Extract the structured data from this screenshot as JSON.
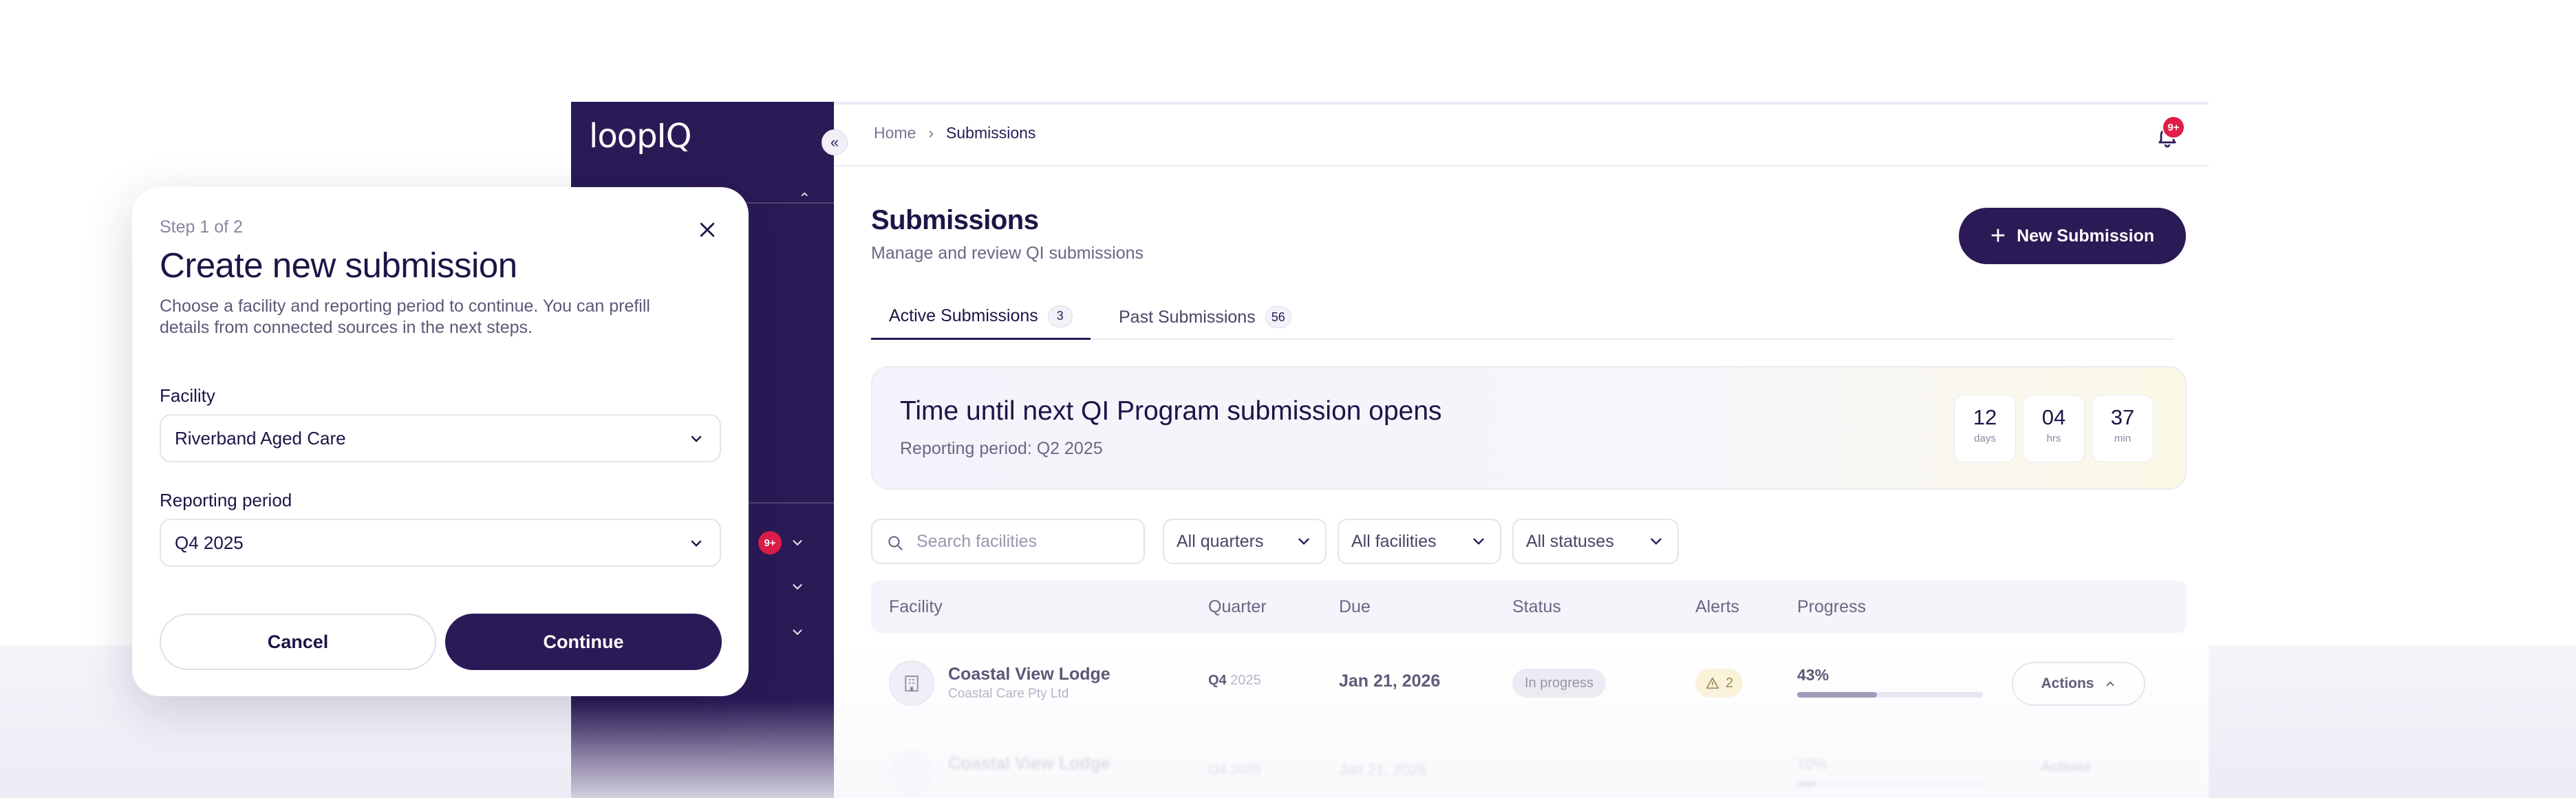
{
  "app": {
    "logo": "loopIQ"
  },
  "sidebar": {
    "partial_text": "t",
    "badge": "9+"
  },
  "breadcrumb": {
    "home": "Home",
    "separator": "›",
    "current": "Submissions"
  },
  "notifications": {
    "badge": "9+"
  },
  "page": {
    "title": "Submissions",
    "subtitle": "Manage and review QI submissions",
    "new_button": "New Submission"
  },
  "tabs": [
    {
      "label": "Active Submissions",
      "count": "3",
      "active": true
    },
    {
      "label": "Past Submissions",
      "count": "56",
      "active": false
    }
  ],
  "banner": {
    "title": "Time until next QI Program submission opens",
    "subtitle": "Reporting period: Q2 2025",
    "countdown": [
      {
        "value": "12",
        "unit": "days"
      },
      {
        "value": "04",
        "unit": "hrs"
      },
      {
        "value": "37",
        "unit": "min"
      }
    ]
  },
  "filters": {
    "search_placeholder": "Search facilities",
    "quarters": "All quarters",
    "facilities": "All facilities",
    "statuses": "All statuses"
  },
  "table": {
    "columns": [
      "Facility",
      "Quarter",
      "Due",
      "Status",
      "Alerts",
      "Progress"
    ],
    "rows": [
      {
        "facility": "Coastal View Lodge",
        "organisation": "Coastal Care Pty Ltd",
        "quarter": "Q4",
        "year": "2025",
        "due": "Jan 21, 2026",
        "status": "In progress",
        "alerts": "2",
        "progress": 0.43,
        "progress_label": "43%",
        "actions": "Actions"
      },
      {
        "facility": "Coastal View Lodge",
        "organisation": "",
        "quarter": "Q4",
        "year": "2025",
        "due": "Jan 21, 2026",
        "status": "",
        "alerts": "",
        "progress": 0.1,
        "progress_label": "10%",
        "actions": "Actions"
      }
    ]
  },
  "modal": {
    "step": "Step 1 of 2",
    "title": "Create new submission",
    "description": "Choose a facility and reporting period to continue. You can prefill details from connected sources in the next steps.",
    "facility_label": "Facility",
    "facility_value": "Riverband Aged Care",
    "period_label": "Reporting period",
    "period_value": "Q4 2025",
    "cancel": "Cancel",
    "continue": "Continue"
  },
  "colors": {
    "brand": "#2a1a55",
    "badge": "#e11d48",
    "alert_bg": "#fbf2d5"
  }
}
